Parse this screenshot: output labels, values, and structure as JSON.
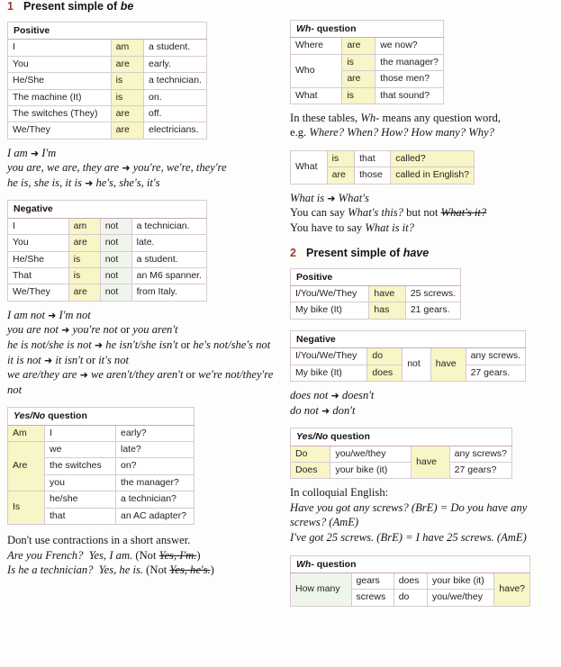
{
  "page": {
    "sections": [
      {
        "num": "1",
        "title_pre": "Present simple of ",
        "title_it": "be"
      },
      {
        "num": "2",
        "title_pre": "Present simple of ",
        "title_it": "have"
      }
    ]
  },
  "be_positive": {
    "header": "Positive",
    "rows": [
      {
        "subject": "I",
        "verb": "am",
        "rest": "a student."
      },
      {
        "subject": "You",
        "verb": "are",
        "rest": "early."
      },
      {
        "subject": "He/She",
        "verb": "is",
        "rest": "a technician."
      },
      {
        "subject": "The machine (It)",
        "verb": "is",
        "rest": "on."
      },
      {
        "subject": "The switches (They)",
        "verb": "are",
        "rest": "off."
      },
      {
        "subject": "We/They",
        "verb": "are",
        "rest": "electricians."
      }
    ]
  },
  "be_positive_notes": {
    "line1_a": "I am",
    "line1_b": "I'm",
    "line2_a": "you are, we are, they are",
    "line2_b": "you're, we're, they're",
    "line3_a": "he is, she is, it is",
    "line3_b": "he's,  she's, it's"
  },
  "be_negative": {
    "header": "Negative",
    "rows": [
      {
        "subject": "I",
        "verb": "am",
        "not": "not",
        "rest": "a technician."
      },
      {
        "subject": "You",
        "verb": "are",
        "not": "not",
        "rest": "late."
      },
      {
        "subject": "He/She",
        "verb": "is",
        "not": "not",
        "rest": "a student."
      },
      {
        "subject": "That",
        "verb": "is",
        "not": "not",
        "rest": "an M6 spanner."
      },
      {
        "subject": "We/They",
        "verb": "are",
        "not": "not",
        "rest": "from Italy."
      }
    ]
  },
  "be_negative_notes": {
    "l1a": "I am not",
    "l1b": "I'm not",
    "l2a": "you are not",
    "l2b": "you're not",
    "l2or": "or",
    "l2c": "you aren't",
    "l3a": "he is not/she is not",
    "l3b": "he isn't/she isn't",
    "l3or": "or",
    "l3c": "he's not/she's not",
    "l4a": "it is not",
    "l4b": "it isn't",
    "l4or": "or",
    "l4c": "it's not",
    "l5a": "we are/they are",
    "l5b": "we aren't/they aren't",
    "l5or": "or",
    "l5c": "we're not/they're not"
  },
  "be_yesno": {
    "header_wh": "Yes/No",
    "header_rest": " question",
    "rows": [
      {
        "aux": "Am",
        "aux_span": 1,
        "subject": "I",
        "rest": "early?"
      },
      {
        "aux": "Are",
        "aux_span": 3,
        "subject": "we",
        "rest": "late?"
      },
      {
        "subject": "the switches",
        "rest": "on?"
      },
      {
        "subject": "you",
        "rest": "the manager?"
      },
      {
        "aux": "Is",
        "aux_span": 2,
        "subject": "he/she",
        "rest": "a technician?"
      },
      {
        "subject": "that",
        "rest": "an AC adapter?"
      }
    ]
  },
  "be_shortanswer": {
    "line1": "Don't use contractions in a short answer.",
    "line2_q": "Are you French?",
    "line2_a": "Yes, I am.",
    "line2_not_open": "(Not ",
    "line2_wrong": "Yes, I'm.",
    "line2_close": ")",
    "line3_q": "Is he a technician?",
    "line3_a": "Yes, he is.",
    "line3_not_open": "(Not ",
    "line3_wrong": "Yes, he's.",
    "line3_close": ")"
  },
  "be_wh": {
    "header_wh": "Wh-",
    "header_rest": " question",
    "rows": [
      {
        "word": "Where",
        "word_span": 1,
        "verb": "are",
        "rest": "we now?"
      },
      {
        "word": "Who",
        "word_span": 2,
        "verb": "is",
        "rest": "the manager?"
      },
      {
        "verb": "are",
        "rest": "those men?"
      },
      {
        "word": "What",
        "word_span": 1,
        "verb": "is",
        "rest": "that sound?"
      }
    ]
  },
  "wh_note": {
    "l1_a": "In these tables, ",
    "l1_wh": "Wh-",
    "l1_b": " means any question word,",
    "l2_a": "e.g. ",
    "l2_examples": "Where? When? How? How many? Why?"
  },
  "what_table": {
    "subject": "What",
    "rows": [
      {
        "verb": "is",
        "det": "that",
        "rest": "called?"
      },
      {
        "verb": "are",
        "det": "those",
        "rest": "called in English?"
      }
    ]
  },
  "what_notes": {
    "l1_a": "What is",
    "l1_b": "What's",
    "l2_a": "You can say ",
    "l2_it1": "What's this?",
    "l2_b": " but not ",
    "l2_wrong": "What's it?",
    "l3_a": "You have to say ",
    "l3_it": "What is it?"
  },
  "have_positive": {
    "header": "Positive",
    "rows": [
      {
        "subject": "I/You/We/They",
        "verb": "have",
        "rest": "25 screws."
      },
      {
        "subject": "My bike (It)",
        "verb": "has",
        "rest": "21 gears."
      }
    ]
  },
  "have_negative": {
    "header": "Negative",
    "rows": [
      {
        "subject": "I/You/We/They",
        "aux": "do",
        "rest": "any screws."
      },
      {
        "subject": "My bike (It)",
        "aux": "does",
        "rest": "27 gears."
      }
    ],
    "not": "not",
    "have": "have"
  },
  "have_negative_notes": {
    "l1a": "does not",
    "l1b": "doesn't",
    "l2a": "do not",
    "l2b": "don't"
  },
  "have_yesno": {
    "header_wh": "Yes/No",
    "header_rest": " question",
    "rows": [
      {
        "aux": "Do",
        "subject": "you/we/they",
        "rest": "any screws?"
      },
      {
        "aux": "Does",
        "subject": "your bike (it)",
        "rest": "27 gears?"
      }
    ],
    "have": "have"
  },
  "colloquial": {
    "intro": "In colloquial English:",
    "l1": "Have you got any screws? (BrE) = Do you have any screws? (AmE)",
    "l2": "I've got 25 screws. (BrE) = I have 25 screws. (AmE)"
  },
  "have_wh": {
    "header_wh": "Wh-",
    "header_rest": " question",
    "subject": "How many",
    "have": "have?",
    "rows": [
      {
        "noun": "gears",
        "aux": "does",
        "person": "your bike (it)"
      },
      {
        "noun": "screws",
        "aux": "do",
        "person": "you/we/they"
      }
    ]
  },
  "colors": {
    "accent": "#9c3c26",
    "highlight_yellow": "#f8f5c6",
    "highlight_green": "#f0f5ec"
  }
}
